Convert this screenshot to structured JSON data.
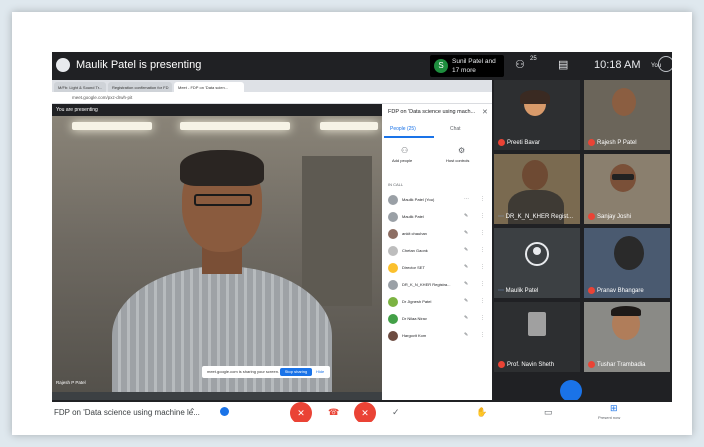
{
  "topbar": {
    "presenting_title": "Maulik Patel is presenting",
    "chip_initial": "S",
    "chip_text": "Sunil Patel and 17 more",
    "participant_count": "25",
    "time": "10:18 AM",
    "you_label": "You"
  },
  "browser": {
    "tabs": [
      {
        "label": "M/Fb: Light & Sound Tr..."
      },
      {
        "label": "Registration confirmation for FD"
      },
      {
        "label": "Meet - FDP on 'Data scien..."
      }
    ],
    "url": "meet.google.com/pxz-drwh-pit"
  },
  "presentation": {
    "presenting_label": "You are presenting",
    "camera_name": "Rajesh P Patel",
    "share_text": "meet.google.com is sharing your screen.",
    "stop_sharing": "Stop sharing",
    "hide": "Hide"
  },
  "people_panel": {
    "title": "FDP on 'Data science using mach...",
    "close": "✕",
    "tab_people": "People (25)",
    "tab_chat": "Chat",
    "add_people": "Add people",
    "host_controls": "Host controls",
    "list_header": "IN CALL",
    "people": [
      {
        "name": "Maulik Patel (You)",
        "color": "#9aa0a6"
      },
      {
        "name": "Maulik Patel",
        "color": "#9aa0a6"
      },
      {
        "name": "ankit chauhan",
        "color": "#8d6e63"
      },
      {
        "name": "Chetan Gaonk",
        "color": "#bdbdbd"
      },
      {
        "name": "Director SET",
        "color": "#fbc02d"
      },
      {
        "name": "DR_K_N_KHER Registra...",
        "color": "#9aa0a6"
      },
      {
        "name": "Dr Jignesh Patel",
        "color": "#7cb342"
      },
      {
        "name": "Dr Nilaa Nirav",
        "color": "#43a047"
      },
      {
        "name": "Hargovit Kom",
        "color": "#6d4c41"
      }
    ]
  },
  "tiles": [
    {
      "name": "Preeti Bavar",
      "muted": true
    },
    {
      "name": "Rajesh P Patel",
      "muted": true
    },
    {
      "name": "DR_K_N_KHER Regist...",
      "muted": false
    },
    {
      "name": "Sanjay Joshi",
      "muted": true
    },
    {
      "name": "Maulik Patel",
      "muted": false
    },
    {
      "name": "Pranav Bhangare",
      "muted": true
    },
    {
      "name": "Prof. Navin Sheth",
      "muted": true
    },
    {
      "name": "Tushar Trambadia",
      "muted": true
    }
  ],
  "bottombar": {
    "meeting_title": "FDP on 'Data science using machine le...",
    "present_now": "Present now"
  },
  "colors": {
    "accent": "#1a73e8",
    "danger": "#ea4335",
    "dark": "#202124"
  }
}
